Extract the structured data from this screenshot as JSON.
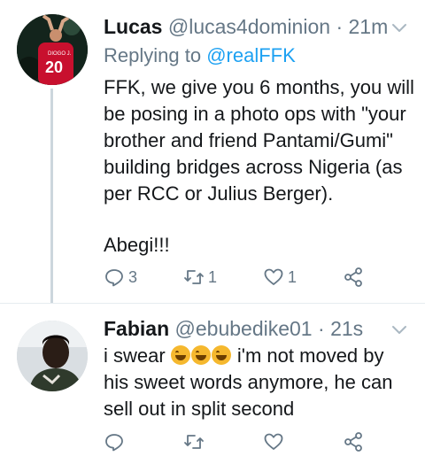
{
  "tweets": [
    {
      "name": "Lucas",
      "handle": "@lucas4dominion",
      "separator": "·",
      "time": "21m",
      "replying_prefix": "Replying to ",
      "replying_to": "@realFFK",
      "lines": [
        "FFK, we give you 6 months, you will",
        "be posing in a photo ops with \"your",
        "brother and friend Pantami/Gumi\"",
        "building bridges across Nigeria (as",
        "per RCC or Julius Berger).",
        "",
        "Abegi!!!"
      ],
      "avatar_jersey_number": "20",
      "avatar_jersey_name": "DIOGO J.",
      "counts": {
        "replies": "3",
        "retweets": "1",
        "likes": "1"
      }
    },
    {
      "name": "Fabian",
      "handle": "@ebubedike01",
      "separator": "·",
      "time": "21s",
      "line1_before": "i swear ",
      "line1_after": " i'm not moved by",
      "lines": [
        "his sweet words anymore, he can",
        "sell out in split second"
      ],
      "emoji": "face-with-tears-of-joy",
      "emoji_count": 3
    }
  ],
  "colors": {
    "text": "#14171a",
    "secondary": "#657786",
    "link": "#1da1f2",
    "divider": "#e6ecf0",
    "thread_line": "#ccd6dd"
  }
}
